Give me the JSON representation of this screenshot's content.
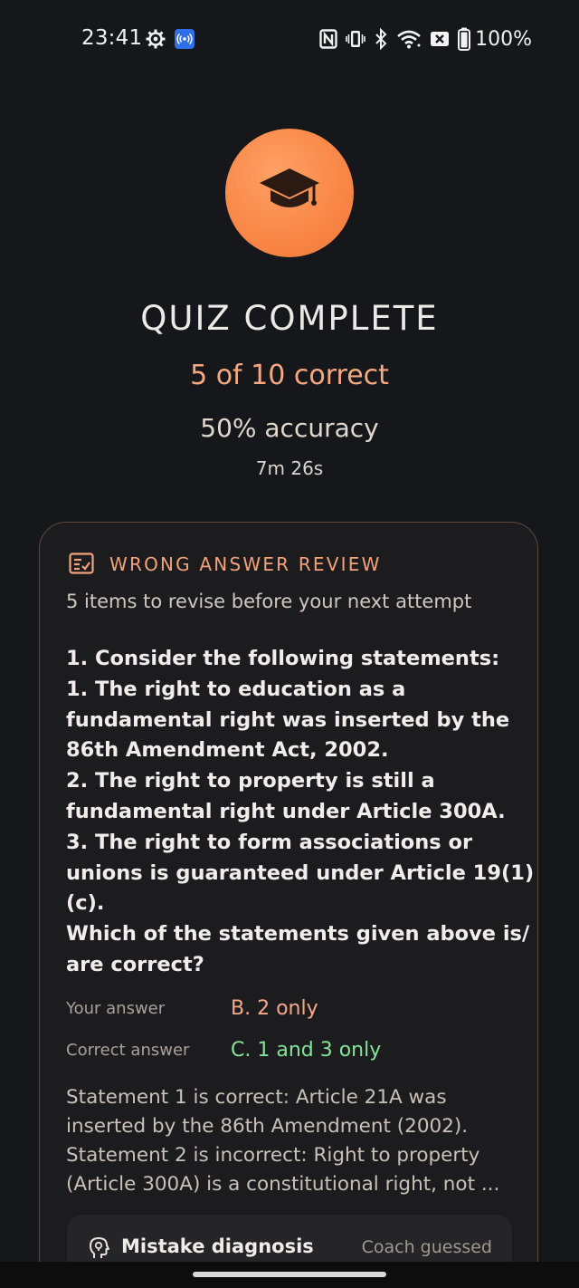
{
  "status_bar": {
    "time": "23:41",
    "battery": "100%",
    "icons": [
      "settings-gear-icon",
      "cast-icon",
      "nfc-icon",
      "vibrate-icon",
      "bluetooth-icon",
      "wifi-icon",
      "sim-off-icon",
      "battery-icon"
    ]
  },
  "hero": {
    "icon": "graduation-cap-icon",
    "title": "QUIZ COMPLETE",
    "score": "5 of 10 correct",
    "accuracy": "50% accuracy",
    "duration": "7m 26s"
  },
  "review": {
    "icon": "checklist-icon",
    "heading": "WRONG ANSWER REVIEW",
    "subtitle": "5 items to revise before your next attempt",
    "question_lines": [
      "1. Consider the following statements:",
      "1. The right to education as a",
      "fundamental right was inserted by the",
      "86th Amendment Act, 2002.",
      "2. The right to property is still a",
      "fundamental right under Article 300A.",
      "3. The right to form associations or",
      "unions is guaranteed under Article 19(1)",
      "(c).",
      "Which of the statements given above is/",
      "are correct?"
    ],
    "your_answer_label": "Your answer",
    "your_answer": "B. 2 only",
    "correct_answer_label": "Correct answer",
    "correct_answer": "C. 1 and 3 only",
    "explanation_lines": [
      "Statement 1 is correct: Article 21A was",
      "inserted by the 86th Amendment (2002).",
      "Statement 2 is incorrect: Right to property",
      "(Article 300A) is a constitutional right, not ..."
    ],
    "diagnosis": {
      "icon": "lightbulb-head-icon",
      "title": "Mistake diagnosis",
      "tag": "Coach guessed"
    }
  },
  "colors": {
    "accent": "#f3a37b",
    "wrong": "#f6a98a",
    "correct": "#84e39a",
    "background": "#16171a"
  }
}
